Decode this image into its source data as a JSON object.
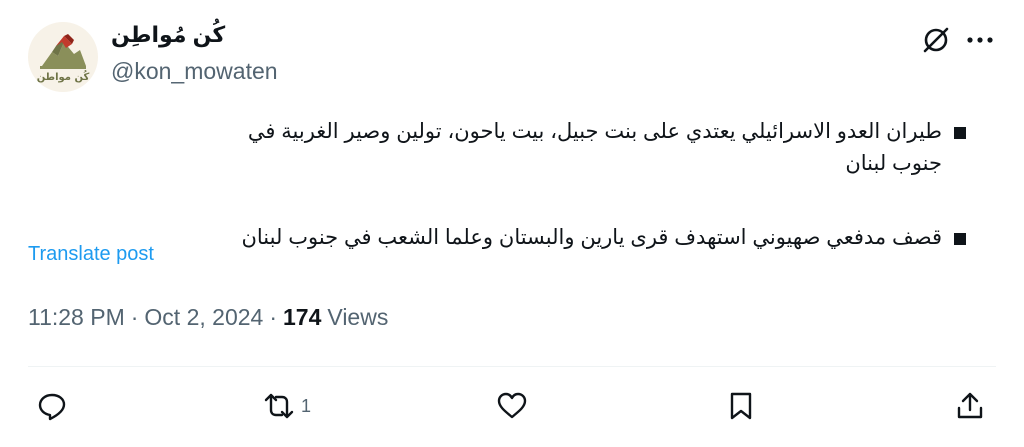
{
  "account": {
    "display_name": "كُن مُواطِن",
    "handle": "@kon_mowaten",
    "avatar_logo_text": "كُن مواطن"
  },
  "post": {
    "lines": [
      "طيران العدو الاسرائيلي يعتدي على بنت جبيل، بيت ياحون، تولين وصير الغربية في جنوب لبنان",
      "قصف مدفعي صهيوني استهدف قرى يارين والبستان وعلما الشعب في جنوب لبنان"
    ],
    "translate_label": "Translate post"
  },
  "meta": {
    "time": "11:28 PM",
    "separator1": "·",
    "date": "Oct 2, 2024",
    "separator2": "·",
    "views_count": "174",
    "views_label": "Views"
  },
  "actions": {
    "retweet_count": "1"
  },
  "icons": {
    "grok": "grok-icon",
    "more": "more-icon",
    "reply": "reply-icon",
    "retweet": "retweet-icon",
    "like": "heart-icon",
    "bookmark": "bookmark-icon",
    "share": "share-icon"
  },
  "colors": {
    "link": "#1d9bf0",
    "secondary_text": "#536471",
    "primary_text": "#0f1419"
  }
}
